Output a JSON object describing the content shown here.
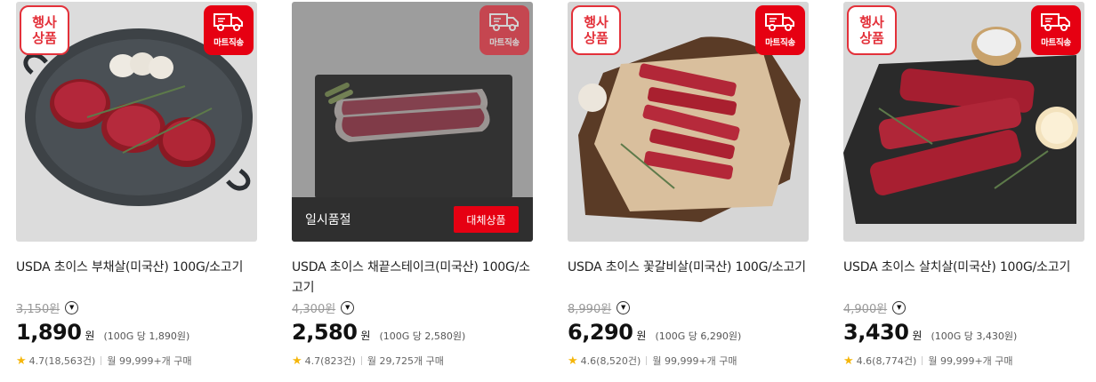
{
  "products": [
    {
      "event_badge": [
        "행사",
        "상품"
      ],
      "delivery_badge": "마트직송",
      "title": "USDA 초이스 부채살(미국산) 100G/소고기",
      "original_price": "3,150원",
      "price": "1,890",
      "currency": "원",
      "unit_price": "(100G 당 1,890원)",
      "rating": "4.7(18,563건)",
      "purchases": "월 99,999+개 구매",
      "sold_out": false
    },
    {
      "event_badge": null,
      "delivery_badge": "마트직송",
      "title": "USDA 초이스 채끝스테이크(미국산) 100G/소고기",
      "original_price": "4,300원",
      "price": "2,580",
      "currency": "원",
      "unit_price": "(100G 당 2,580원)",
      "rating": "4.7(823건)",
      "purchases": "월 29,725개 구매",
      "sold_out": true,
      "sold_out_text": "일시품절",
      "substitute_label": "대체상품"
    },
    {
      "event_badge": [
        "행사",
        "상품"
      ],
      "delivery_badge": "마트직송",
      "title": "USDA 초이스 꽃갈비살(미국산) 100G/소고기",
      "original_price": "8,990원",
      "price": "6,290",
      "currency": "원",
      "unit_price": "(100G 당 6,290원)",
      "rating": "4.6(8,520건)",
      "purchases": "월 99,999+개 구매",
      "sold_out": false
    },
    {
      "event_badge": [
        "행사",
        "상품"
      ],
      "delivery_badge": "마트직송",
      "title": "USDA 초이스 살치살(미국산) 100G/소고기",
      "original_price": "4,900원",
      "price": "3,430",
      "currency": "원",
      "unit_price": "(100G 당 3,430원)",
      "rating": "4.6(8,774건)",
      "purchases": "월 99,999+개 구매",
      "sold_out": false
    }
  ],
  "colors": {
    "accent": "#e60012",
    "star": "#f5b60a"
  },
  "icons": {
    "delivery": "truck-icon",
    "info": "chevron-down-circle-icon",
    "rating": "star-icon"
  }
}
